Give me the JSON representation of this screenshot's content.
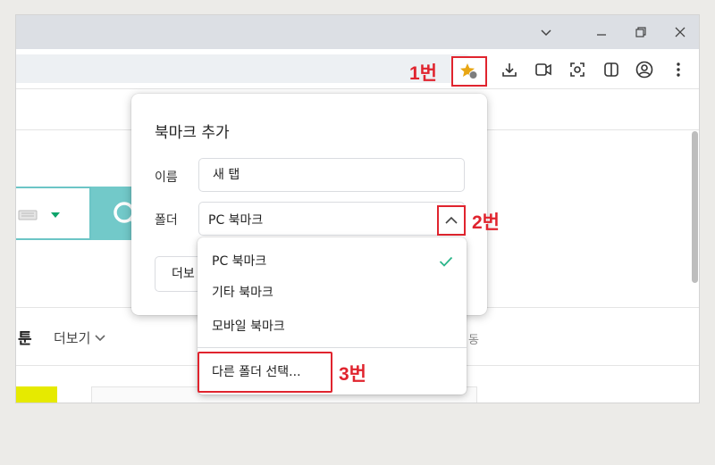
{
  "browser": {
    "window_controls": {
      "chevron": "chevron-down-icon",
      "minimize": "minimize-icon",
      "restore": "restore-icon",
      "close": "close-icon"
    },
    "toolbar_icons": [
      "bookmark-star-icon",
      "download-icon",
      "video-camera-icon",
      "screenshot-icon",
      "split-view-icon",
      "profile-icon",
      "kebab-menu-icon"
    ]
  },
  "annotations": {
    "step1": "1번",
    "step2": "2번",
    "step3": "3번"
  },
  "page": {
    "section_heading": "툰",
    "more_link": "더보기",
    "partial_text": "동"
  },
  "bookmark_dialog": {
    "title": "북마크 추가",
    "name_label": "이름",
    "name_value": "새 탭",
    "folder_label": "폴더",
    "folder_value": "PC 북마크",
    "more_button": "더보"
  },
  "folder_dropdown": {
    "items": [
      {
        "label": "PC 북마크",
        "selected": true
      },
      {
        "label": "기타 북마크",
        "selected": false
      },
      {
        "label": "모바일 북마크",
        "selected": false
      }
    ],
    "choose_other": "다른 폴더 선택..."
  },
  "colors": {
    "accent_red": "#e0242e",
    "search_teal": "#72c9c9",
    "check_green": "#2bb58a",
    "highlight_yellow": "#e6ea00"
  }
}
